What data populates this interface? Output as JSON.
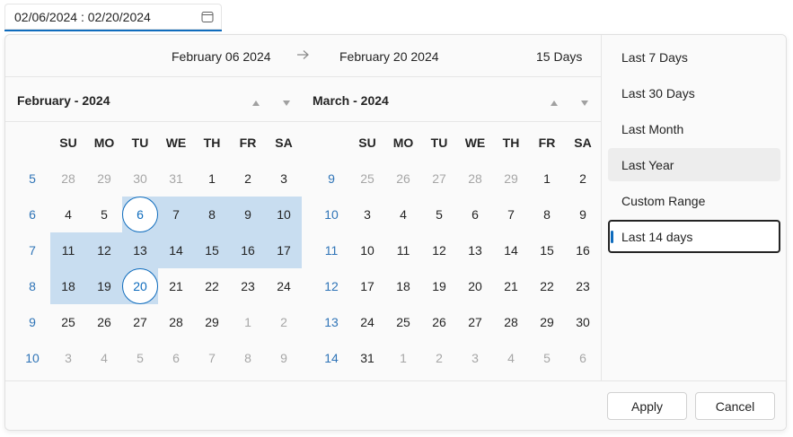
{
  "input": {
    "value": "02/06/2024 : 02/20/2024",
    "icon": "calendar-icon"
  },
  "range": {
    "start": "February 06 2024",
    "end": "February 20 2024",
    "days": "15 Days",
    "arrow_icon": "arrow-right-icon"
  },
  "accent": "#0f6cbd",
  "range_fill": "#c8ddf0",
  "weekdays": [
    "SU",
    "MO",
    "TU",
    "WE",
    "TH",
    "FR",
    "SA"
  ],
  "months": [
    {
      "title": "February - 2024",
      "weeks": [
        {
          "wk": "5",
          "days": [
            {
              "d": "28",
              "o": true
            },
            {
              "d": "29",
              "o": true
            },
            {
              "d": "30",
              "o": true
            },
            {
              "d": "31",
              "o": true
            },
            {
              "d": "1"
            },
            {
              "d": "2"
            },
            {
              "d": "3"
            }
          ]
        },
        {
          "wk": "6",
          "days": [
            {
              "d": "4"
            },
            {
              "d": "5"
            },
            {
              "d": "6",
              "s": "sel"
            },
            {
              "d": "7",
              "s": "in"
            },
            {
              "d": "8",
              "s": "in"
            },
            {
              "d": "9",
              "s": "in"
            },
            {
              "d": "10",
              "s": "in"
            }
          ]
        },
        {
          "wk": "7",
          "days": [
            {
              "d": "11",
              "s": "in"
            },
            {
              "d": "12",
              "s": "in"
            },
            {
              "d": "13",
              "s": "in"
            },
            {
              "d": "14",
              "s": "in"
            },
            {
              "d": "15",
              "s": "in"
            },
            {
              "d": "16",
              "s": "in"
            },
            {
              "d": "17",
              "s": "in"
            }
          ]
        },
        {
          "wk": "8",
          "days": [
            {
              "d": "18",
              "s": "in"
            },
            {
              "d": "19",
              "s": "in"
            },
            {
              "d": "20",
              "s": "sel"
            },
            {
              "d": "21"
            },
            {
              "d": "22"
            },
            {
              "d": "23"
            },
            {
              "d": "24"
            }
          ]
        },
        {
          "wk": "9",
          "days": [
            {
              "d": "25"
            },
            {
              "d": "26"
            },
            {
              "d": "27"
            },
            {
              "d": "28"
            },
            {
              "d": "29"
            },
            {
              "d": "1",
              "o": true
            },
            {
              "d": "2",
              "o": true
            }
          ]
        },
        {
          "wk": "10",
          "days": [
            {
              "d": "3",
              "o": true
            },
            {
              "d": "4",
              "o": true
            },
            {
              "d": "5",
              "o": true
            },
            {
              "d": "6",
              "o": true
            },
            {
              "d": "7",
              "o": true
            },
            {
              "d": "8",
              "o": true
            },
            {
              "d": "9",
              "o": true
            }
          ]
        }
      ]
    },
    {
      "title": "March - 2024",
      "weeks": [
        {
          "wk": "9",
          "days": [
            {
              "d": "25",
              "o": true
            },
            {
              "d": "26",
              "o": true
            },
            {
              "d": "27",
              "o": true
            },
            {
              "d": "28",
              "o": true
            },
            {
              "d": "29",
              "o": true
            },
            {
              "d": "1"
            },
            {
              "d": "2"
            }
          ]
        },
        {
          "wk": "10",
          "days": [
            {
              "d": "3"
            },
            {
              "d": "4"
            },
            {
              "d": "5"
            },
            {
              "d": "6"
            },
            {
              "d": "7"
            },
            {
              "d": "8"
            },
            {
              "d": "9"
            }
          ]
        },
        {
          "wk": "11",
          "days": [
            {
              "d": "10"
            },
            {
              "d": "11"
            },
            {
              "d": "12"
            },
            {
              "d": "13"
            },
            {
              "d": "14"
            },
            {
              "d": "15"
            },
            {
              "d": "16"
            }
          ]
        },
        {
          "wk": "12",
          "days": [
            {
              "d": "17"
            },
            {
              "d": "18"
            },
            {
              "d": "19"
            },
            {
              "d": "20"
            },
            {
              "d": "21"
            },
            {
              "d": "22"
            },
            {
              "d": "23"
            }
          ]
        },
        {
          "wk": "13",
          "days": [
            {
              "d": "24"
            },
            {
              "d": "25"
            },
            {
              "d": "26"
            },
            {
              "d": "27"
            },
            {
              "d": "28"
            },
            {
              "d": "29"
            },
            {
              "d": "30"
            }
          ]
        },
        {
          "wk": "14",
          "days": [
            {
              "d": "31"
            },
            {
              "d": "1",
              "o": true
            },
            {
              "d": "2",
              "o": true
            },
            {
              "d": "3",
              "o": true
            },
            {
              "d": "4",
              "o": true
            },
            {
              "d": "5",
              "o": true
            },
            {
              "d": "6",
              "o": true
            }
          ]
        }
      ]
    }
  ],
  "presets": [
    {
      "label": "Last 7 Days"
    },
    {
      "label": "Last 30 Days"
    },
    {
      "label": "Last Month"
    },
    {
      "label": "Last Year",
      "state": "hover"
    },
    {
      "label": "Custom Range"
    },
    {
      "label": "Last 14 days",
      "state": "active"
    }
  ],
  "footer": {
    "apply_label": "Apply",
    "cancel_label": "Cancel"
  }
}
